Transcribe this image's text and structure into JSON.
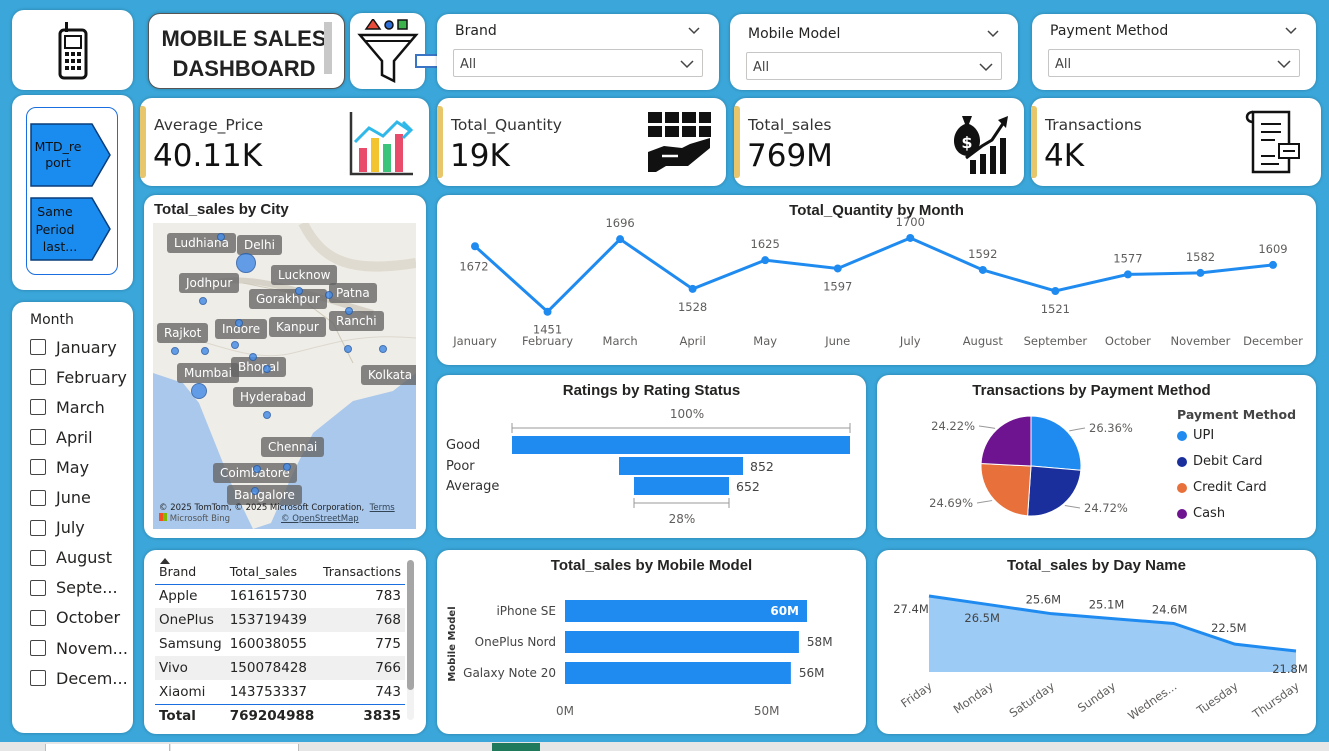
{
  "dashboard_title": {
    "line1": "MOBILE SALES",
    "line2": "DASHBOARD"
  },
  "nav": {
    "mtd_button": "MTD_report",
    "spl_button": "Same Period last...",
    "mtd_line1": "MTD_re",
    "mtd_line2": "port",
    "spl_line1": "Same",
    "spl_line2": "Period",
    "spl_line3": "last..."
  },
  "slicers": {
    "brand": {
      "label": "Brand",
      "value": "All"
    },
    "model": {
      "label": "Mobile Model",
      "value": "All"
    },
    "payment": {
      "label": "Payment Method",
      "value": "All"
    }
  },
  "kpis": [
    {
      "label": "Average_Price",
      "value": "40.11K"
    },
    {
      "label": "Total_Quantity",
      "value": "19K"
    },
    {
      "label": "Total_sales",
      "value": "769M"
    },
    {
      "label": "Transactions",
      "value": "4K"
    }
  ],
  "month_slicer": {
    "label": "Month",
    "items": [
      "January",
      "February",
      "March",
      "April",
      "May",
      "June",
      "July",
      "August",
      "Septe...",
      "October",
      "Novem...",
      "Decem..."
    ]
  },
  "map": {
    "title": "Total_sales by City",
    "cities": [
      "Ludhiana",
      "Delhi",
      "Jodhpur",
      "Lucknow",
      "Gorakhpur",
      "Patna",
      "Rajkot",
      "Indore",
      "Kanpur",
      "Ranchi",
      "Mumbai",
      "Bhopal",
      "Kolkata",
      "Hyderabad",
      "Chennai",
      "Coimbatore",
      "Bangalore"
    ],
    "attribution": "© 2025 TomTom, © 2025 Microsoft Corporation,",
    "terms": "Terms",
    "osm": "© OpenStreetMap",
    "bing": "Microsoft Bing"
  },
  "brand_table": {
    "headers": [
      "Brand",
      "Total_sales",
      "Transactions"
    ],
    "rows": [
      [
        "Apple",
        "161615730",
        "783"
      ],
      [
        "OnePlus",
        "153719439",
        "768"
      ],
      [
        "Samsung",
        "160038055",
        "775"
      ],
      [
        "Vivo",
        "150078428",
        "766"
      ],
      [
        "Xiaomi",
        "143753337",
        "743"
      ]
    ],
    "total": [
      "Total",
      "769204988",
      "3835"
    ]
  },
  "chart_data": [
    {
      "id": "quantity_by_month",
      "type": "line",
      "title": "Total_Quantity by Month",
      "categories": [
        "January",
        "February",
        "March",
        "April",
        "May",
        "June",
        "July",
        "August",
        "September",
        "October",
        "November",
        "December"
      ],
      "values": [
        1672,
        1451,
        1696,
        1528,
        1625,
        1597,
        1700,
        1592,
        1521,
        1577,
        1582,
        1609
      ],
      "ylim": [
        1440,
        1710
      ],
      "color": "#1f8bf0"
    },
    {
      "id": "ratings",
      "type": "bar",
      "title": "Ratings by Rating Status",
      "categories": [
        "Good",
        "Poor",
        "Average"
      ],
      "values": [
        2331,
        852,
        652
      ],
      "value_labels": [
        "",
        "852",
        "652"
      ],
      "top_pct": "100%",
      "bottom_pct": "28%",
      "color": "#1f8bf0"
    },
    {
      "id": "payment_pie",
      "type": "pie",
      "title": "Transactions by Payment Method",
      "legend_title": "Payment Method",
      "categories": [
        "UPI",
        "Debit Card",
        "Credit Card",
        "Cash"
      ],
      "values": [
        26.36,
        24.72,
        24.69,
        24.22
      ],
      "labels": [
        "26.36%",
        "24.72%",
        "24.69%",
        "24.22%"
      ],
      "colors": [
        "#1f8bf0",
        "#1a2f9c",
        "#e8703a",
        "#6e1490"
      ]
    },
    {
      "id": "sales_by_model",
      "type": "bar",
      "title": "Total_sales by Mobile Model",
      "ylabel": "Mobile Model",
      "categories": [
        "iPhone SE",
        "OnePlus Nord",
        "Galaxy Note 20"
      ],
      "values": [
        60,
        58,
        56
      ],
      "value_labels": [
        "60M",
        "58M",
        "56M"
      ],
      "xticks": [
        "0M",
        "50M"
      ],
      "xlim": [
        0,
        60
      ],
      "color": "#1f8bf0"
    },
    {
      "id": "sales_by_day",
      "type": "area",
      "title": "Total_sales by Day Name",
      "categories": [
        "Friday",
        "Monday",
        "Saturday",
        "Sunday",
        "Wednes...",
        "Tuesday",
        "Thursday"
      ],
      "values": [
        27.4,
        26.5,
        25.6,
        25.1,
        24.6,
        22.5,
        21.8
      ],
      "value_labels": [
        "27.4M",
        "26.5M",
        "25.6M",
        "25.1M",
        "24.6M",
        "22.5M",
        "21.8M"
      ],
      "ylim": [
        21.5,
        27.6
      ],
      "color": "#1f8bf0",
      "fill": "#9ccbf5"
    }
  ]
}
